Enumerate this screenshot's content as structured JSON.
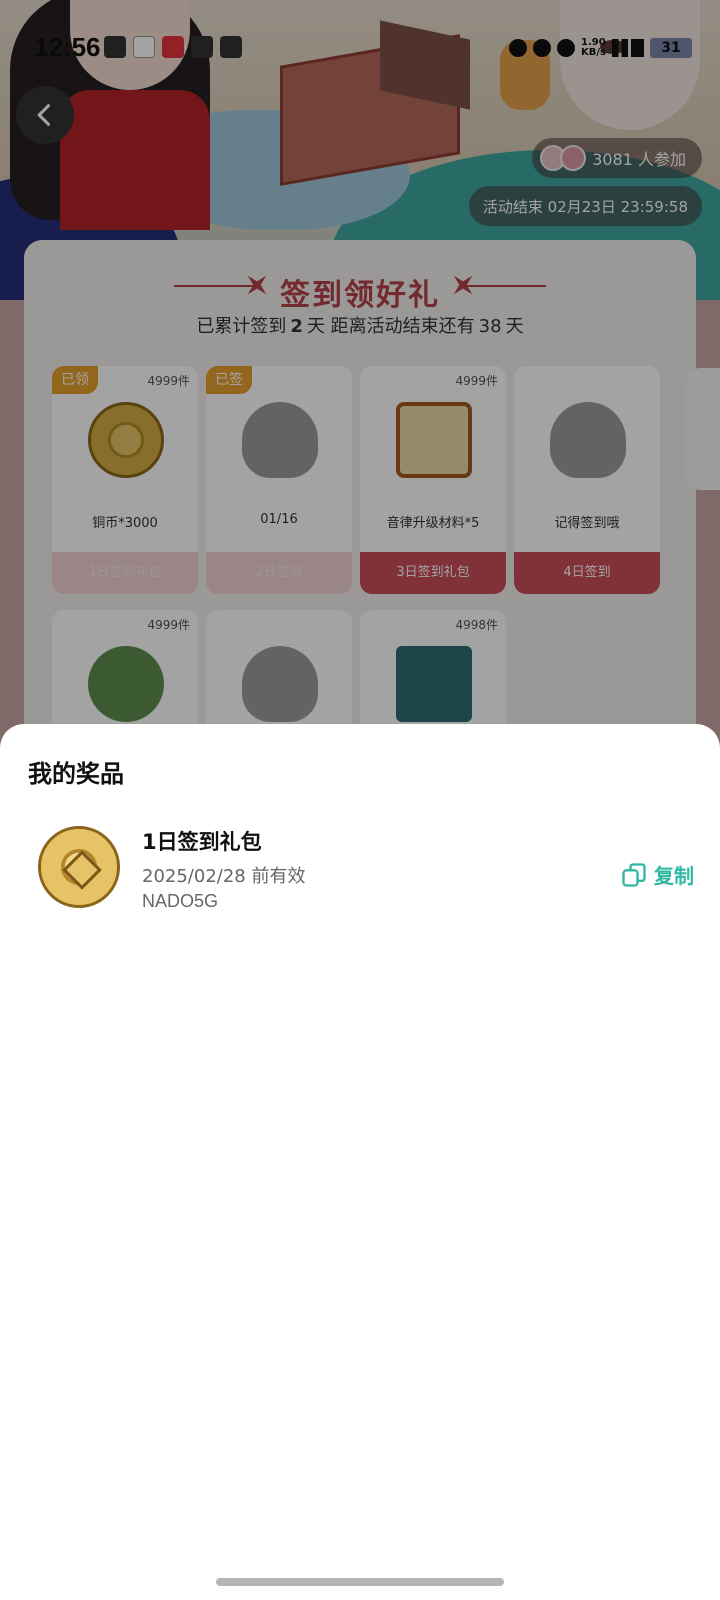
{
  "status_bar": {
    "time": "12:56",
    "net_speed_top": "1.90",
    "net_speed_bottom": "KB/s",
    "battery": "31"
  },
  "header": {
    "participants": "3081 人参加",
    "end_time": "活动结束 02月23日 23:59:58"
  },
  "checkin": {
    "title": "签到领好礼",
    "progress_prefix": "已累计签到",
    "days_signed": "2",
    "progress_middle": "天  距离活动结束还有",
    "days_left": "38",
    "progress_suffix": "天",
    "tiles": [
      {
        "badge": "已领",
        "stock": "4999件",
        "name": "铜币*3000",
        "footer": "1日签到礼包",
        "art": "coin-icon"
      },
      {
        "badge": "已签",
        "stock": "",
        "name": "01/16",
        "footer": "2日签到",
        "art": "placeholder-avatar-icon"
      },
      {
        "badge": "",
        "stock": "4999件",
        "name": "音律升级材料*5",
        "footer": "3日签到礼包",
        "art": "music-scroll-icon"
      },
      {
        "badge": "",
        "stock": "",
        "name": "记得签到哦",
        "footer": "4日签到",
        "art": "placeholder-avatar-icon"
      },
      {
        "badge": "",
        "stock": "4999件",
        "name": "",
        "footer": "",
        "art": "lotus-leaf-icon"
      },
      {
        "badge": "",
        "stock": "",
        "name": "",
        "footer": "",
        "art": "placeholder-avatar-icon"
      },
      {
        "badge": "",
        "stock": "4998件",
        "name": "",
        "footer": "",
        "art": "almanac-book-icon"
      }
    ]
  },
  "sheet": {
    "title": "我的奖品",
    "prize": {
      "name": "1日签到礼包",
      "expiry": "2025/02/28 前有效",
      "code": "NADO5G",
      "copy_label": "复制",
      "icon": "coin-icon"
    }
  },
  "colors": {
    "accent": "#2fb7a1",
    "card_red": "#c94f58",
    "badge_orange": "#e6a02e"
  }
}
